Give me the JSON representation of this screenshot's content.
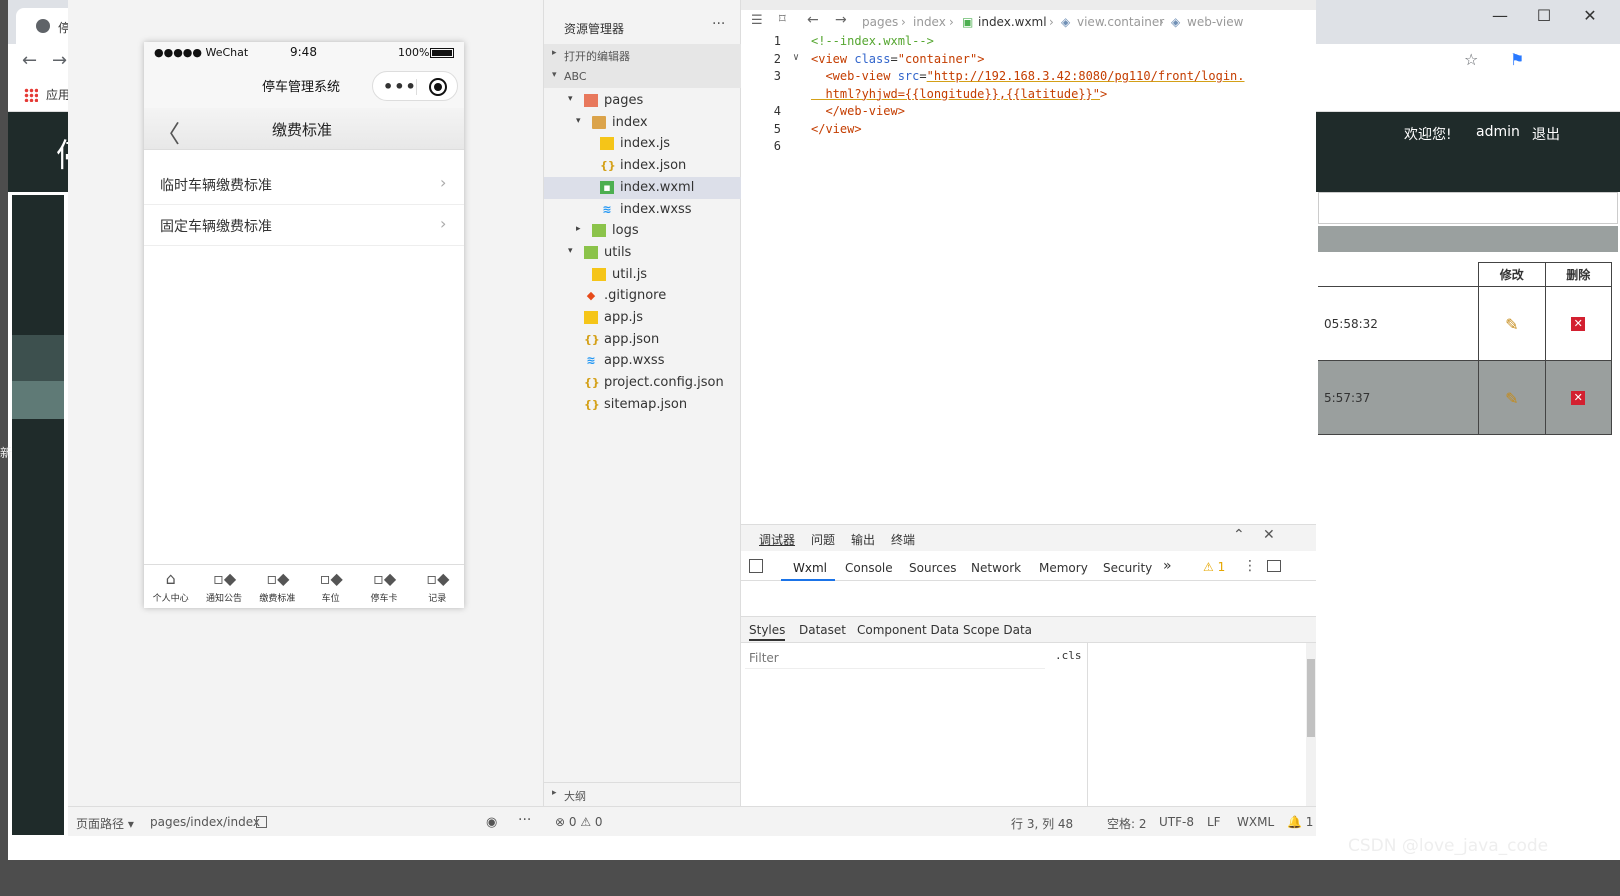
{
  "browser": {
    "tab_title": "停",
    "bookmark_apps": "应用",
    "header": {
      "logo_char": "停",
      "welcome": "欢迎您!",
      "user": "admin",
      "logout": "退出"
    },
    "table": {
      "headers": [
        "修改",
        "删除"
      ],
      "rows": [
        {
          "time": "05:58:32"
        },
        {
          "time": "5:57:37"
        }
      ]
    },
    "side_glyph": "新"
  },
  "simulator": {
    "status": {
      "carrier": "●●●●● WeChat",
      "time": "9:48",
      "battery": "100%"
    },
    "app_title": "停车管理系统",
    "nav_title": "缴费标准",
    "list": [
      {
        "label": "临时车辆缴费标准"
      },
      {
        "label": "固定车辆缴费标准"
      }
    ],
    "tabbar": [
      {
        "label": "个人中心",
        "icon": "home-icon"
      },
      {
        "label": "通知公告",
        "icon": "grid-icon"
      },
      {
        "label": "缴费标准",
        "icon": "grid-icon"
      },
      {
        "label": "车位",
        "icon": "grid-icon"
      },
      {
        "label": "停车卡",
        "icon": "grid-icon"
      },
      {
        "label": "记录",
        "icon": "grid-icon"
      }
    ],
    "page_path_label": "页面路径 ▾",
    "page_path": "pages/index/index"
  },
  "explorer": {
    "title": "资源管理器",
    "open_editors": "打开的编辑器",
    "project": "ABC",
    "tree": [
      {
        "name": "pages",
        "type": "folder-red",
        "depth": 1,
        "caret": "▾"
      },
      {
        "name": "index",
        "type": "folder",
        "depth": 2,
        "caret": "▾"
      },
      {
        "name": "index.js",
        "type": "js",
        "depth": 3,
        "caret": ""
      },
      {
        "name": "index.json",
        "type": "json",
        "depth": 3,
        "caret": ""
      },
      {
        "name": "index.wxml",
        "type": "wxml",
        "depth": 3,
        "caret": "",
        "selected": true
      },
      {
        "name": "index.wxss",
        "type": "wxss",
        "depth": 3,
        "caret": ""
      },
      {
        "name": "logs",
        "type": "folder-green",
        "depth": 2,
        "caret": "▸"
      },
      {
        "name": "utils",
        "type": "folder-green",
        "depth": 1,
        "caret": "▾"
      },
      {
        "name": "util.js",
        "type": "js",
        "depth": 2,
        "caret": ""
      },
      {
        "name": ".gitignore",
        "type": "git",
        "depth": 1,
        "caret": ""
      },
      {
        "name": "app.js",
        "type": "js",
        "depth": 1,
        "caret": ""
      },
      {
        "name": "app.json",
        "type": "json",
        "depth": 1,
        "caret": ""
      },
      {
        "name": "app.wxss",
        "type": "wxss",
        "depth": 1,
        "caret": ""
      },
      {
        "name": "project.config.json",
        "type": "json",
        "depth": 1,
        "caret": ""
      },
      {
        "name": "sitemap.json",
        "type": "json",
        "depth": 1,
        "caret": ""
      }
    ],
    "outline": "大纲"
  },
  "editor": {
    "breadcrumb": [
      "pages",
      "index",
      "index.wxml",
      "view.container",
      "web-view"
    ],
    "lines": [
      {
        "n": "1",
        "fold": "",
        "parts": [
          [
            "c-comment",
            "<!--index.wxml-->"
          ]
        ]
      },
      {
        "n": "2",
        "fold": "∨",
        "parts": [
          [
            "c-tag",
            "<view "
          ],
          [
            "c-attr",
            "class"
          ],
          [
            "c-plain",
            "="
          ],
          [
            "c-str",
            "\"container\""
          ],
          [
            "c-tag",
            ">"
          ]
        ]
      },
      {
        "n": "3",
        "fold": "",
        "parts": [
          [
            "c-tag",
            "  <web-view "
          ],
          [
            "c-attr",
            "src"
          ],
          [
            "c-plain",
            "="
          ],
          [
            "c-str",
            "\"http://192.168.3.42:8080/pg110/front/login."
          ]
        ]
      },
      {
        "n": "",
        "fold": "",
        "parts": [
          [
            "c-str",
            "  html?yhjwd={{longitude}},{{latitude}}\""
          ],
          [
            "c-tag",
            ">"
          ]
        ]
      },
      {
        "n": "4",
        "fold": "",
        "parts": [
          [
            "c-tag",
            "  </web-view>"
          ]
        ]
      },
      {
        "n": "5",
        "fold": "",
        "parts": [
          [
            "c-tag",
            "</view>"
          ]
        ]
      },
      {
        "n": "6",
        "fold": "",
        "parts": [
          [
            "c-plain",
            ""
          ]
        ]
      }
    ]
  },
  "debugger": {
    "top_tabs": [
      "调试器",
      "问题",
      "输出",
      "终端"
    ],
    "tabs": [
      "Wxml",
      "Console",
      "Sources",
      "Network",
      "Memory",
      "Security"
    ],
    "more": "»",
    "warning_count": "⚠ 1",
    "sub_tabs": [
      "Styles",
      "Dataset",
      "Component Data",
      "Scope Data"
    ],
    "filter_placeholder": "Filter",
    "cls": ".cls"
  },
  "status_bar": {
    "errors": "⊗ 0 ⚠ 0",
    "position": "行 3, 列 48",
    "indent": "空格: 2",
    "encoding": "UTF-8",
    "eol": "LF",
    "language": "WXML",
    "notifications": "🔔 1"
  },
  "watermark": "CSDN @love_java_code"
}
